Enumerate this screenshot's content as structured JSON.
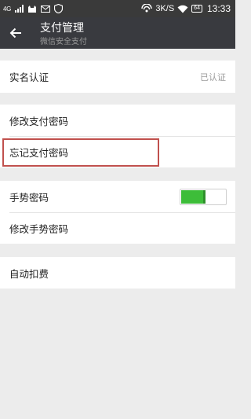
{
  "status_bar": {
    "network": "4G",
    "speed": "3K/S",
    "battery": "64",
    "time": "13:33",
    "icons": [
      "signal-icon",
      "cat-icon",
      "mail-icon",
      "shield-icon",
      "hotspot-icon",
      "wifi-icon",
      "battery-icon"
    ]
  },
  "header": {
    "title": "支付管理",
    "subtitle": "微信安全支付",
    "back_icon": "arrow-left-icon"
  },
  "sections": {
    "verification": {
      "label": "实名认证",
      "value": "已认证"
    },
    "password": {
      "change_label": "修改支付密码",
      "forgot_label": "忘记支付密码"
    },
    "gesture": {
      "toggle_label": "手势密码",
      "toggle_on": true,
      "change_label": "修改手势密码"
    },
    "auto_debit": {
      "label": "自动扣费"
    }
  },
  "colors": {
    "status_bar_bg": "#3a3a3a",
    "title_bar_bg": "#393a3f",
    "page_bg": "#ececec",
    "toggle_on": "#3dbd39",
    "highlight": "#c0504d"
  }
}
